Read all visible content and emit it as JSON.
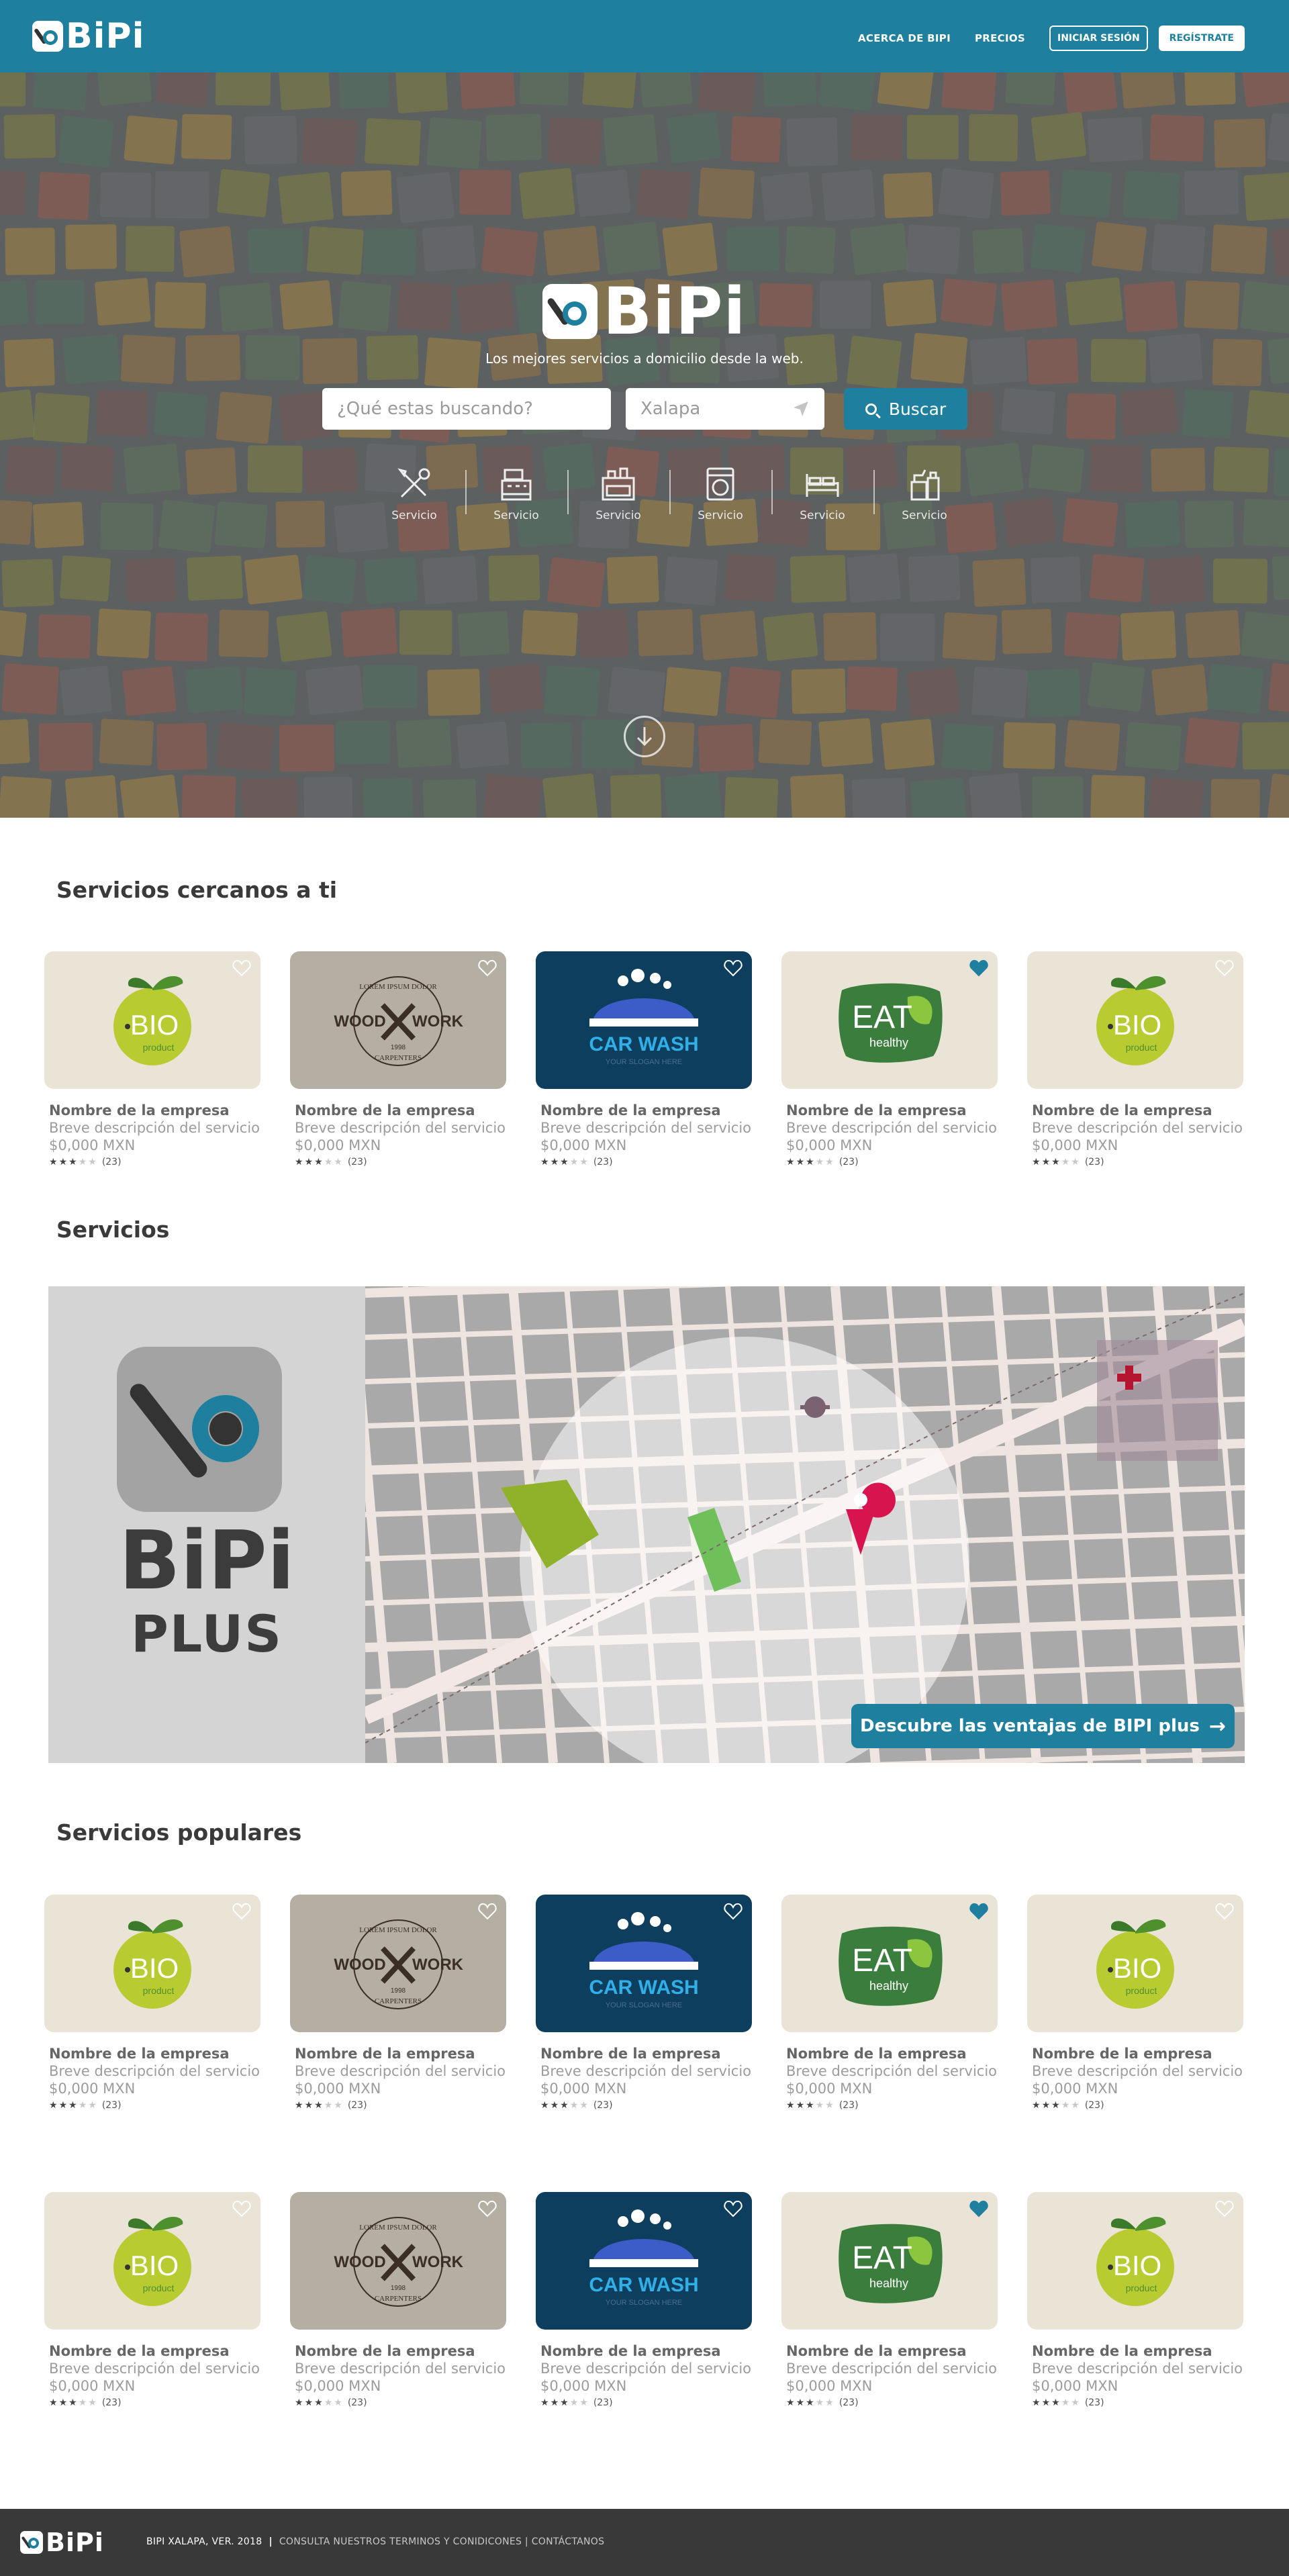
{
  "brand": {
    "name": "BiPi"
  },
  "nav": {
    "about": "ACERCA DE BIPI",
    "pricing": "PRECIOS",
    "login": "INICIAR SESIÓN",
    "register": "REGÍSTRATE"
  },
  "hero": {
    "tagline": "Los mejores servicios a domicilio desde la web.",
    "search_placeholder": "¿Qué estas buscando?",
    "location_value": "Xalapa",
    "search_button": "Buscar",
    "categories": [
      {
        "label": "Servicio",
        "icon": "tools-icon"
      },
      {
        "label": "Servicio",
        "icon": "cash-register-icon"
      },
      {
        "label": "Servicio",
        "icon": "kitchen-stove-icon"
      },
      {
        "label": "Servicio",
        "icon": "washing-machine-icon"
      },
      {
        "label": "Servicio",
        "icon": "bed-icon"
      },
      {
        "label": "Servicio",
        "icon": "cleaning-supplies-icon"
      }
    ]
  },
  "nearby": {
    "title": "Servicios cercanos a ti"
  },
  "services": {
    "title": "Servicios",
    "plus_brand": "BiPi",
    "plus_label": "PLUS",
    "cta": "Descubre las ventajas de BIPI plus"
  },
  "popular": {
    "title": "Servicios populares"
  },
  "card_template": {
    "name": "Nombre de la empresa",
    "desc": "Breve descripción del servicio",
    "price": "$0,000 MXN",
    "rating": 3,
    "count": "(23)"
  },
  "card_logos": {
    "bio_word": "BIO",
    "bio_small": "product",
    "wood_top": "LOREM IPSUM DOLOR",
    "wood_left": "WOOD",
    "wood_right": "WORK",
    "wood_year": "1998",
    "wood_bottom": "CARPENTERS",
    "car_title": "CAR WASH",
    "car_slogan": "YOUR SLOGAN HERE",
    "eat_word": "EAT",
    "eat_small": "healthy"
  },
  "footer": {
    "version": "BIPI XALAPA, VER.  2018",
    "links": "CONSULTA NUESTROS TERMINOS Y CONIDICONES | CONTÁCTANOS"
  },
  "colors": {
    "primary": "#1f7f9e",
    "footer": "#393939",
    "heading": "#3a3a3a"
  }
}
